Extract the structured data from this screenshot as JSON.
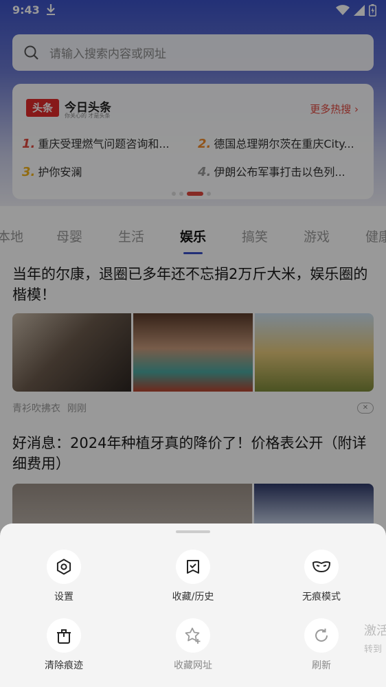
{
  "status_bar": {
    "time": "9:43"
  },
  "search": {
    "placeholder": "请输入搜索内容或网址"
  },
  "hot_panel": {
    "logo_text": "头条",
    "brand": "今日头条",
    "slogan": "你关心的 才是头条",
    "more_label": "更多热搜 ›",
    "items": [
      {
        "rank": "1.",
        "text": "重庆受理燃气问题咨询和...",
        "color": "#e0483f"
      },
      {
        "rank": "2.",
        "text": "德国总理朔尔茨在重庆City...",
        "color": "#f08a2a"
      },
      {
        "rank": "3.",
        "text": "护你安澜",
        "color": "#f2b21c"
      },
      {
        "rank": "4.",
        "text": "伊朗公布军事打击以色列...",
        "color": "#9a9a9a"
      }
    ]
  },
  "tabs": [
    "本地",
    "母婴",
    "生活",
    "娱乐",
    "搞笑",
    "游戏",
    "健康"
  ],
  "active_tab_index": 3,
  "news": [
    {
      "title": "当年的尔康，退圈已多年还不忘捐2万斤大米，娱乐圈的楷模！",
      "source": "青衫吹拂衣",
      "time": "刚刚",
      "close_label": "✕"
    },
    {
      "title": "好消息：2024年种植牙真的降价了！价格表公开（附详细费用）"
    }
  ],
  "sheet": {
    "actions": [
      {
        "label": "设置",
        "icon": "settings-hex-icon",
        "enabled": true
      },
      {
        "label": "收藏/历史",
        "icon": "bookmark-history-icon",
        "enabled": true
      },
      {
        "label": "无痕模式",
        "icon": "mask-icon",
        "enabled": true
      },
      {
        "label": "清除痕迹",
        "icon": "clear-trash-icon",
        "enabled": true
      },
      {
        "label": "收藏网址",
        "icon": "star-add-icon",
        "enabled": false
      },
      {
        "label": "刷新",
        "icon": "refresh-icon",
        "enabled": false
      }
    ],
    "extra_text_1": "激活",
    "extra_text_2": "转到"
  },
  "colors": {
    "accent": "#3a4fc7",
    "hot_red": "#e0483f"
  }
}
